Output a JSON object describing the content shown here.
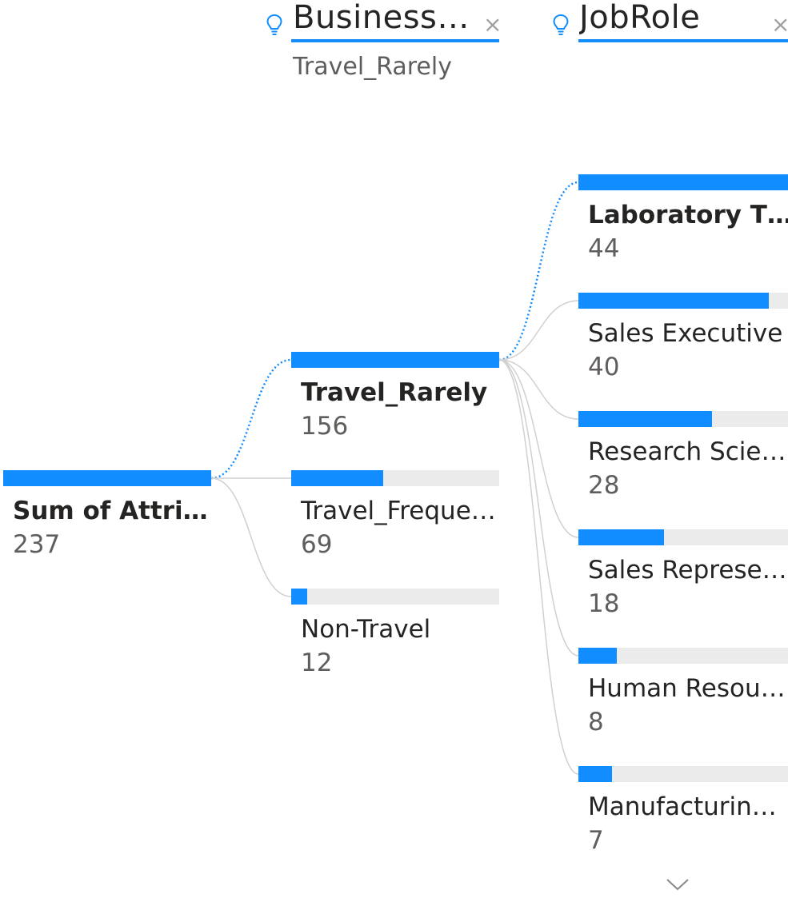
{
  "colors": {
    "accent": "#118dff",
    "track": "#ebebeb",
    "connector": "#d0d0d0",
    "text": "#252423",
    "subtext": "#605e5c"
  },
  "levels": [
    {
      "title": "Business…",
      "selected": "Travel_Rarely",
      "bulb_icon": "lightbulb-icon",
      "close_icon": "close-icon",
      "close_glyph": "×"
    },
    {
      "title": "JobRole",
      "selected": "",
      "bulb_icon": "lightbulb-icon",
      "close_icon": "close-icon",
      "close_glyph": "×"
    }
  ],
  "scroll_icon": "chevron-down-icon",
  "chart_data": {
    "type": "decomposition-tree",
    "root": {
      "label": "Sum of Attri…",
      "value": 237
    },
    "levels": [
      {
        "field": "Business…",
        "selected": "Travel_Rarely",
        "nodes": [
          {
            "label": "Travel_Rarely",
            "value": 156,
            "selected": true
          },
          {
            "label": "Travel_Freque…",
            "value": 69
          },
          {
            "label": "Non-Travel",
            "value": 12
          }
        ]
      },
      {
        "field": "JobRole",
        "nodes": [
          {
            "label": "Laboratory T…",
            "value": 44,
            "selected": true
          },
          {
            "label": "Sales Executive",
            "value": 40
          },
          {
            "label": "Research Scie…",
            "value": 28
          },
          {
            "label": "Sales Represe…",
            "value": 18
          },
          {
            "label": "Human Resou…",
            "value": 8
          },
          {
            "label": "Manufacturin…",
            "value": 7
          }
        ]
      }
    ]
  }
}
